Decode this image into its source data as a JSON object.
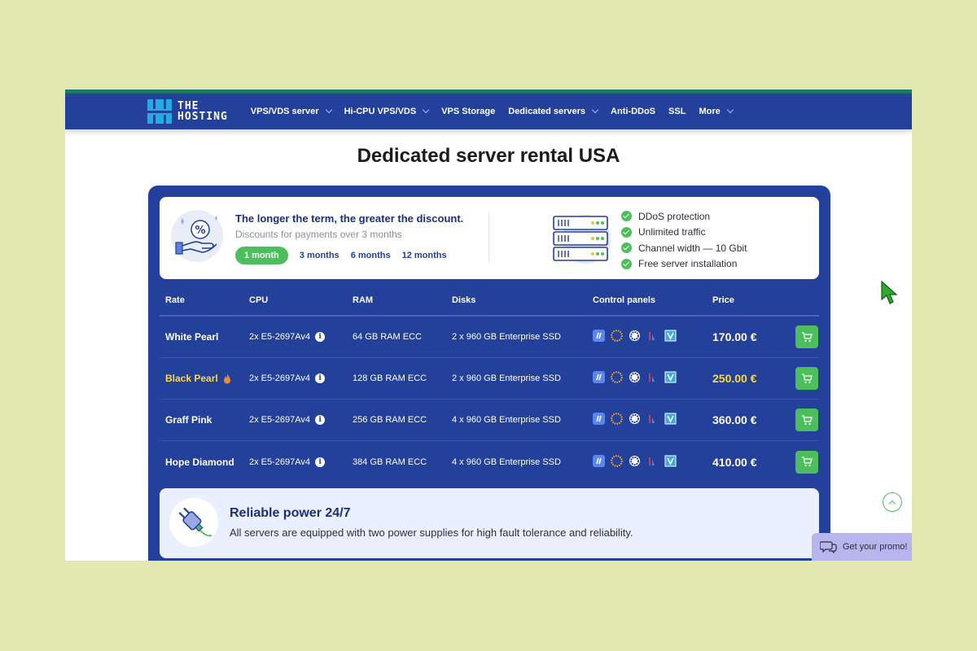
{
  "logo": {
    "line1": "THE",
    "line2": "HOSTING"
  },
  "nav": [
    {
      "label": "VPS/VDS server",
      "dropdown": true
    },
    {
      "label": "Hi-CPU VPS/VDS",
      "dropdown": true
    },
    {
      "label": "VPS Storage",
      "dropdown": false
    },
    {
      "label": "Dedicated servers",
      "dropdown": true
    },
    {
      "label": "Anti-DDoS",
      "dropdown": false
    },
    {
      "label": "SSL",
      "dropdown": false
    },
    {
      "label": "More",
      "dropdown": true
    }
  ],
  "page_title": "Dedicated server rental USA",
  "promo": {
    "title": "The longer the term, the greater the discount.",
    "subtitle": "Discounts for payments over 3 months",
    "terms": [
      "1 month",
      "3 months",
      "6 months",
      "12 months"
    ],
    "active_term": "1 month"
  },
  "features": [
    "DDoS protection",
    "Unlimited traffic",
    "Channel width — 10 Gbit",
    "Free server installation"
  ],
  "table": {
    "headers": {
      "rate": "Rate",
      "cpu": "CPU",
      "ram": "RAM",
      "disks": "Disks",
      "panels": "Control panels",
      "price": "Price"
    },
    "rows": [
      {
        "rate": "White Pearl",
        "cpu": "2x E5-2697Av4",
        "ram": "64 GB RAM ECC",
        "disks": "2 x 960 GB Enterprise SSD",
        "price": "170.00 €",
        "hot": false
      },
      {
        "rate": "Black Pearl",
        "cpu": "2x E5-2697Av4",
        "ram": "128 GB RAM ECC",
        "disks": "2 x 960 GB Enterprise SSD",
        "price": "250.00 €",
        "hot": true
      },
      {
        "rate": "Graff Pink",
        "cpu": "2x E5-2697Av4",
        "ram": "256 GB RAM ECC",
        "disks": "4 x 960 GB Enterprise SSD",
        "price": "360.00 €",
        "hot": false
      },
      {
        "rate": "Hope Diamond",
        "cpu": "2x E5-2697Av4",
        "ram": "384 GB RAM ECC",
        "disks": "4 x 960 GB Enterprise SSD",
        "price": "410.00 €",
        "hot": false
      }
    ],
    "panel_icons": [
      "plesk-icon",
      "cpanel-icon",
      "directadmin-icon",
      "ispmanager-icon",
      "vesta-icon"
    ]
  },
  "power": {
    "title": "Reliable power 24/7",
    "description": "All servers are equipped with two power supplies for high fault tolerance and reliability."
  },
  "promo_button": "Get your promo!",
  "colors": {
    "brand": "#23409a",
    "accent": "#4cbf5c",
    "highlight": "#ffd83a",
    "background": "#e2e8b0"
  }
}
